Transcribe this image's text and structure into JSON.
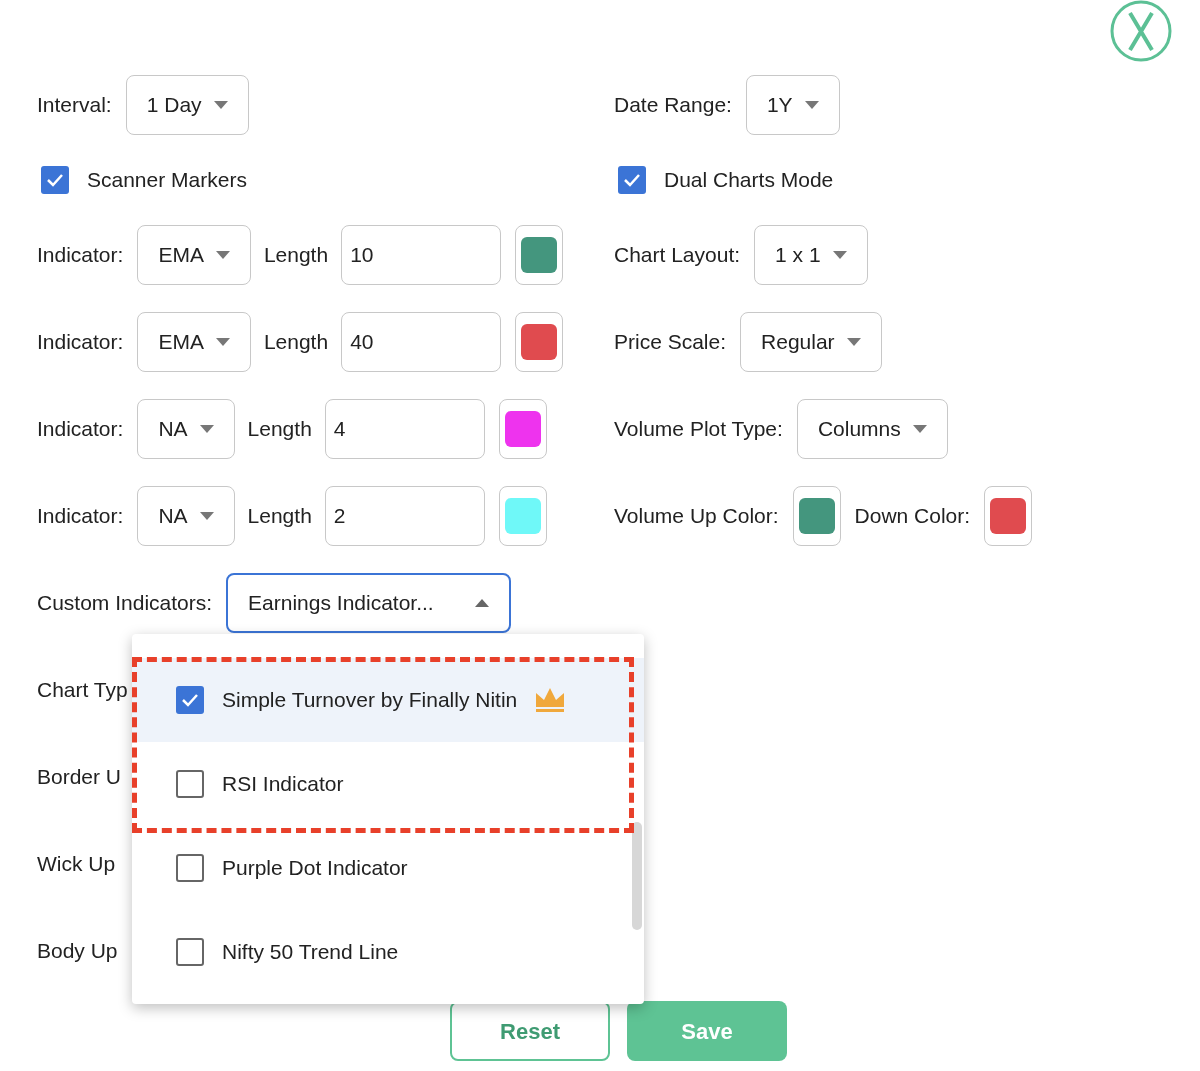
{
  "left": [
    {
      "kind": "select",
      "label": "Interval:",
      "value": "1 Day"
    },
    {
      "kind": "checkbox",
      "label": "Scanner Markers",
      "checked": true
    },
    {
      "kind": "indicator",
      "label": "Indicator:",
      "value": "EMA",
      "length_label": "Length",
      "length": "10",
      "color": "#44967e"
    },
    {
      "kind": "indicator",
      "label": "Indicator:",
      "value": "EMA",
      "length_label": "Length",
      "length": "40",
      "color": "#e04b4f"
    },
    {
      "kind": "indicator",
      "label": "Indicator:",
      "value": "NA",
      "length_label": "Length",
      "length": "4",
      "color": "#ee33ee"
    },
    {
      "kind": "indicator",
      "label": "Indicator:",
      "value": "NA",
      "length_label": "Length",
      "length": "2",
      "color": "#6ff8f8"
    }
  ],
  "right": [
    {
      "kind": "select",
      "label": "Date Range:",
      "value": "1Y"
    },
    {
      "kind": "checkbox",
      "label": "Dual Charts Mode",
      "checked": true
    },
    {
      "kind": "select",
      "label": "Chart Layout:",
      "value": "1 x 1"
    },
    {
      "kind": "select",
      "label": "Price Scale:",
      "value": "Regular"
    },
    {
      "kind": "select",
      "label": "Volume Plot Type:",
      "value": "Columns"
    },
    {
      "kind": "colors",
      "items": [
        {
          "label": "Volume Up Color:",
          "color": "#44967e"
        },
        {
          "label": "Down Color:",
          "color": "#e04b4f"
        }
      ]
    }
  ],
  "custom_indicators": {
    "label": "Custom Indicators:",
    "value": "Earnings Indicator...",
    "expanded": true,
    "options": [
      {
        "label": "Simple Turnover by Finally Nitin",
        "checked": true,
        "highlighted": true,
        "premium": true
      },
      {
        "label": "RSI Indicator",
        "checked": false,
        "highlighted": false,
        "premium": false
      },
      {
        "label": "Purple Dot Indicator",
        "checked": false,
        "highlighted": false,
        "premium": false
      },
      {
        "label": "Nifty 50 Trend Line",
        "checked": false,
        "highlighted": false,
        "premium": false
      }
    ]
  },
  "covered_labels": [
    "Chart Typ",
    "Border U",
    "Wick Up",
    "Body Up"
  ],
  "buttons": [
    {
      "kind": "outline",
      "label": "Reset"
    },
    {
      "kind": "primary",
      "label": "Save"
    }
  ]
}
